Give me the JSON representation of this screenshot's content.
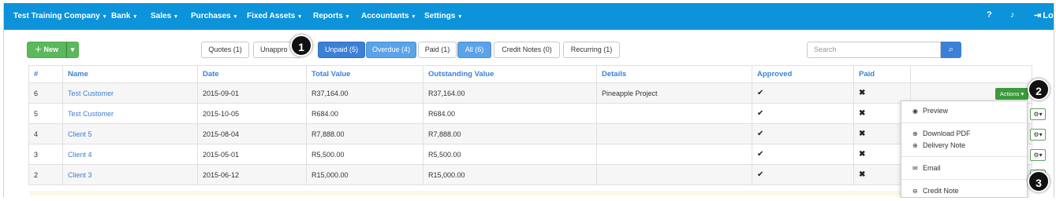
{
  "nav": {
    "company": "Test Training Company",
    "items": [
      "Bank",
      "Sales",
      "Purchases",
      "Fixed Assets",
      "Reports",
      "Accountants",
      "Settings"
    ],
    "right_text": "Lo"
  },
  "toolbar": {
    "new_label": "New",
    "filters": [
      "Quotes (1)",
      "Unappro",
      "Unpaid (5)",
      "Overdue (4)",
      "Paid (1)",
      "All (6)",
      "Credit Notes (0)",
      "Recurring (1)"
    ],
    "search_placeholder": "Search"
  },
  "table": {
    "headers": [
      "#",
      "Name",
      "Date",
      "Total Value",
      "Outstanding Value",
      "Details",
      "Approved",
      "Paid",
      ""
    ],
    "rows": [
      {
        "num": "6",
        "name": "Test Customer",
        "date": "2015-09-01",
        "total": "R37,164.00",
        "outstanding": "R37,164.00",
        "details": "Pineapple Project"
      },
      {
        "num": "5",
        "name": "Test Customer",
        "date": "2015-10-05",
        "total": "R684.00",
        "outstanding": "R684.00",
        "details": ""
      },
      {
        "num": "4",
        "name": "Client 5",
        "date": "2015-08-04",
        "total": "R7,888.00",
        "outstanding": "R7,888.00",
        "details": ""
      },
      {
        "num": "3",
        "name": "Client 4",
        "date": "2015-05-01",
        "total": "R5,500.00",
        "outstanding": "R5,500.00",
        "details": ""
      },
      {
        "num": "2",
        "name": "Client 3",
        "date": "2015-06-12",
        "total": "R15,000.00",
        "outstanding": "R15,000.00",
        "details": ""
      }
    ],
    "actions_label": "Actions"
  },
  "dropdown": {
    "preview": "Preview",
    "download_pdf": "Download PDF",
    "delivery_note": "Delivery Note",
    "email": "Email",
    "credit_note": "Credit Note"
  },
  "callouts": [
    "1",
    "2",
    "3"
  ]
}
